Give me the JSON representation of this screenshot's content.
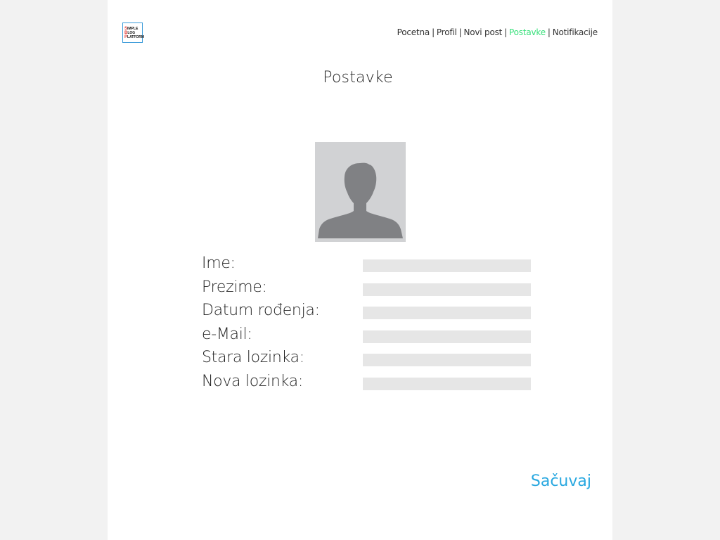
{
  "logo": {
    "line1_cap": "S",
    "line1_rest": "IMPLE",
    "line2_cap": "B",
    "line2_rest": "LOG",
    "line3_cap": "P",
    "line3_rest": "LATFORM",
    "border_color": "#3a9ad9",
    "accent_color": "#e53935"
  },
  "nav": {
    "items": [
      {
        "label": "Pocetna",
        "active": false
      },
      {
        "label": "Profil",
        "active": false
      },
      {
        "label": "Novi post",
        "active": false
      },
      {
        "label": "Postavke",
        "active": true
      },
      {
        "label": "Notifikacije",
        "active": false
      }
    ],
    "separator": "|",
    "active_color": "#38e07b"
  },
  "page": {
    "title": "Postavke"
  },
  "avatar": {
    "icon": "user-silhouette-icon",
    "background_color": "#d1d2d4",
    "silhouette_color": "#808184"
  },
  "form": {
    "fields": [
      {
        "label": "Ime:",
        "value": ""
      },
      {
        "label": "Prezime:",
        "value": ""
      },
      {
        "label": "Datum rođenja:",
        "value": ""
      },
      {
        "label": "e-Mail:",
        "value": ""
      },
      {
        "label": "Stara lozinka:",
        "value": ""
      },
      {
        "label": "Nova lozinka:",
        "value": ""
      }
    ],
    "field_color": "#e6e6e6"
  },
  "actions": {
    "save_label": "Sačuvaj",
    "save_color": "#29a8e0"
  }
}
